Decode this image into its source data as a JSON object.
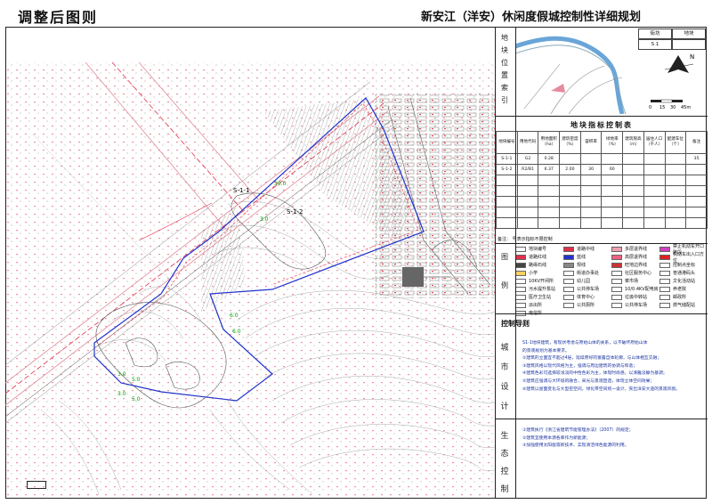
{
  "header": {
    "left_title": "调整后图则",
    "right_title": "新安江（洋安）休闲度假城控制性详细规划"
  },
  "map": {
    "labels": {
      "plot_1": "S-1-1",
      "plot_2": "S-1-2"
    },
    "colors": {
      "boundary": "#2233cc",
      "red_line": "#e0304a",
      "road": "#e08a9a",
      "dim": "#00a000",
      "contour": "#999999",
      "hatch": "#888888"
    }
  },
  "panel": {
    "location_label": "地块位置索引",
    "location_chars": [
      "地",
      "块",
      "位",
      "置",
      "索",
      "引"
    ],
    "street_header": "街坊",
    "plot_header": "地块",
    "street_value": "S 1",
    "scale_values": [
      "0",
      "15",
      "30",
      "45m"
    ],
    "north_mark": "N",
    "index_title": "地块指标控制表",
    "index_columns": [
      "地块编号",
      "用地代码",
      "用地面积（ha）",
      "建筑密度（%）",
      "容积率",
      "绿地率（%）",
      "建筑限高（m）",
      "居住人口（千人）",
      "配建车位（个）",
      "备注"
    ],
    "index_rows": [
      [
        "S-1-1",
        "G2",
        "0.28",
        "",
        "",
        "",
        "",
        "",
        "",
        "35"
      ],
      [
        "S-1-2",
        "R2/B1",
        "6.37",
        "2.00",
        "30",
        "60",
        "",
        "",
        "",
        ""
      ]
    ],
    "note": "备注：    号表示指标不限控制",
    "legend_label": "图例",
    "legend_chars": [
      "图",
      "例"
    ],
    "legend_items": [
      {
        "label": "地块编号",
        "color": "#ffffff",
        "icon": "plot-number"
      },
      {
        "label": "道路中线",
        "color": "#e0304a",
        "icon": "road-centerline"
      },
      {
        "label": "多层退界线",
        "color": "#f0a0b0",
        "icon": "setback-line"
      },
      {
        "label": "禁止机动车开口路段",
        "color": "#d040c0",
        "icon": "no-entry"
      },
      {
        "label": "道路红线",
        "color": "#e0304a",
        "icon": "red-line"
      },
      {
        "label": "蓝线",
        "color": "#2233cc",
        "icon": "blue-line"
      },
      {
        "label": "高层退界线",
        "color": "#f06080",
        "icon": "highrise-setback"
      },
      {
        "label": "机动车出入口方位",
        "color": "#e02020",
        "icon": "arrow-up-icon"
      },
      {
        "label": "路缘石线",
        "color": "#444444",
        "icon": "curb-line"
      },
      {
        "label": "规线",
        "color": "#888888",
        "icon": "rule-line"
      },
      {
        "label": "旺地边界线",
        "color": "#cc3333",
        "icon": "boundary-line"
      },
      {
        "label": "控制点坐标",
        "color": "#ffffff",
        "icon": "control-point"
      },
      {
        "label": "小学",
        "color": "#ffd060",
        "icon": "school-icon"
      },
      {
        "label": "街道办事处",
        "color": "#ffffff",
        "icon": "office-icon"
      },
      {
        "label": "社区服务中心",
        "color": "#ffffff",
        "icon": "community-icon"
      },
      {
        "label": "普通港码头",
        "color": "#ffffff",
        "icon": "port-icon"
      },
      {
        "label": "10KV开闭所",
        "color": "#ffffff",
        "icon": "power-icon"
      },
      {
        "label": "幼儿园",
        "color": "#ffffff",
        "icon": "kindergarten-icon"
      },
      {
        "label": "菜市场",
        "color": "#ffffff",
        "icon": "market-icon"
      },
      {
        "label": "文化活动站",
        "color": "#ffffff",
        "icon": "culture-icon"
      },
      {
        "label": "污水提升泵站",
        "color": "#ffffff",
        "icon": "pump-icon"
      },
      {
        "label": "公共停车场",
        "color": "#ffffff",
        "icon": "parking-icon"
      },
      {
        "label": "10/0.4KV配电房",
        "color": "#ffffff",
        "icon": "substation-icon"
      },
      {
        "label": "养老院",
        "color": "#ffffff",
        "icon": "elderly-icon"
      },
      {
        "label": "医疗卫生站",
        "color": "#ffffff",
        "icon": "clinic-icon"
      },
      {
        "label": "体育中心",
        "color": "#ffffff",
        "icon": "sports-icon"
      },
      {
        "label": "垃圾中转站",
        "color": "#ffffff",
        "icon": "waste-icon"
      },
      {
        "label": "邮政所",
        "color": "#ffffff",
        "icon": "post-icon"
      },
      {
        "label": "派出所",
        "color": "#ffffff",
        "icon": "police-icon"
      },
      {
        "label": "公共厕所",
        "color": "#ffffff",
        "icon": "toilet-icon"
      },
      {
        "label": "公共停车场",
        "color": "#ffffff",
        "icon": "parking-icon"
      },
      {
        "label": "燃气储配站",
        "color": "#ffffff",
        "icon": "gas-icon"
      },
      {
        "label": "电信所",
        "color": "#ffffff",
        "icon": "telecom-icon"
      }
    ],
    "control_guide_title": "控制导则",
    "urban_design_label": "城市设计",
    "urban_design_chars": [
      "城",
      "市",
      "设",
      "计"
    ],
    "urban_design_lines": [
      "S1-1地块建筑，有现状考虑与原始山体的关系，以不破坏原始山体",
      "的景观规划为基本要求。",
      "②建筑的立面宜不超过4层，延续原好的富露自体轮廓，与山体相互交融；",
      "③建筑风格以现代风格为主，强调与周边建筑的协调与和谐；",
      "④建筑色彩可选择较浅淡的中性色彩为主，体现时尚感，以清雅淡静为基调；",
      "⑤建筑应强调与大环境的融合，采光与景观塑造，体现立体空间效果；",
      "⑥建筑以屋面变化与大型密空间，绿化带空间统一设计，突出洋安大道的景观风貌。"
    ],
    "ecology_label": "生态控制",
    "ecology_chars": [
      "生",
      "态",
      "控",
      "制"
    ],
    "ecology_lines": [
      "①建筑执行《浙江省建筑节能管理办法》（2007）的规定；",
      "②建筑宜使用本源各库作为新能源；",
      "③加强使用太阳能等新技术、实现清洁绿色能源的利用。"
    ]
  }
}
